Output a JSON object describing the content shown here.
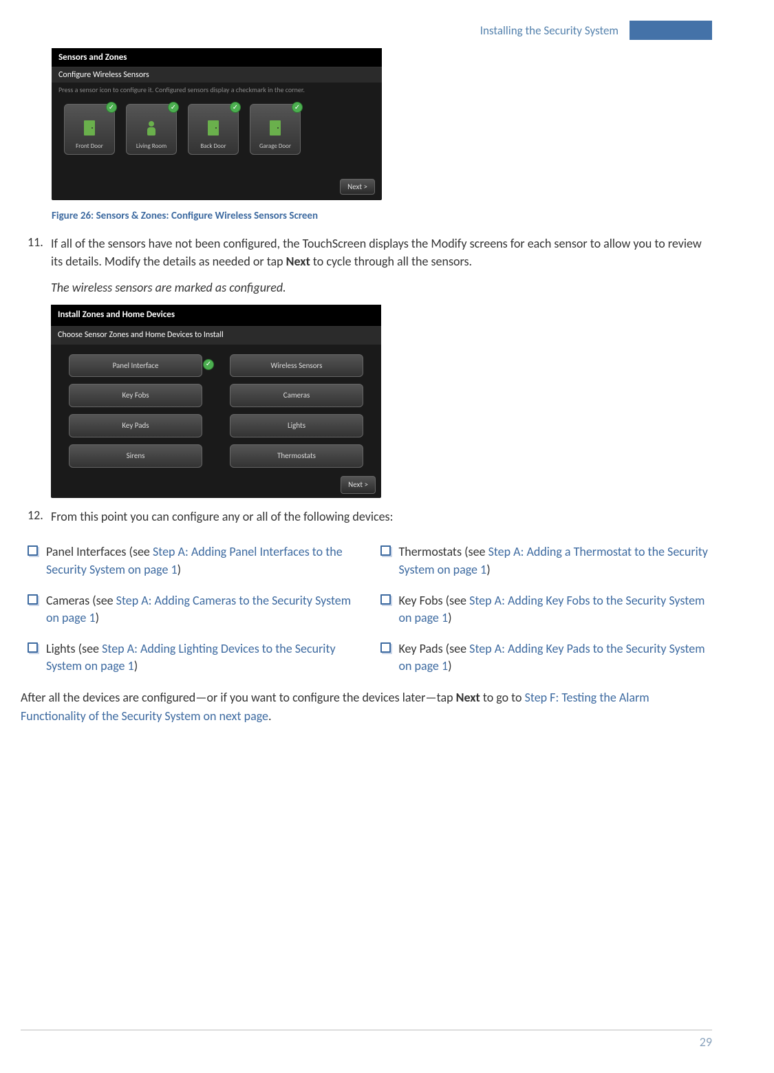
{
  "header": {
    "title": "Installing the Security System"
  },
  "screenshot1": {
    "title": "Sensors and Zones",
    "subtitle": "Configure Wireless Sensors",
    "help": "Press a sensor icon to configure it.  Configured sensors display a checkmark in the corner.",
    "sensors": [
      {
        "label": "Front Door",
        "glyph": "door",
        "checked": true
      },
      {
        "label": "Living Room",
        "glyph": "person",
        "checked": true
      },
      {
        "label": "Back Door",
        "glyph": "door",
        "checked": true
      },
      {
        "label": "Garage Door",
        "glyph": "door",
        "checked": true
      }
    ],
    "next_label": "Next >"
  },
  "figure_caption": "Figure 26:  Sensors & Zones: Configure Wireless Sensors Screen",
  "step11": {
    "num": "11.",
    "text_a": "If all of the sensors have not been configured, the TouchScreen displays the Modify screens for each sensor to allow you to review its details. Modify the details as needed or tap ",
    "bold": "Next",
    "text_b": " to cycle through all the sensors.",
    "italic": "The wireless sensors are marked as configured."
  },
  "screenshot2": {
    "title": "Install Zones and Home Devices",
    "subtitle": "Choose Sensor Zones and Home Devices to Install",
    "devices": [
      {
        "label": "Panel Interface",
        "checked": true
      },
      {
        "label": "Wireless Sensors"
      },
      {
        "label": "Key Fobs"
      },
      {
        "label": "Cameras"
      },
      {
        "label": "Key Pads"
      },
      {
        "label": "Lights"
      },
      {
        "label": "Sirens"
      },
      {
        "label": "Thermostats"
      }
    ],
    "next_label": "Next >"
  },
  "step12": {
    "num": "12.",
    "text": "From this point you can configure any or all of the following devices:"
  },
  "check_items": [
    {
      "lead": "Panel Interfaces (see ",
      "link": "Step A: Adding Panel Interfaces to the Security System on page 1",
      "tail": ")"
    },
    {
      "lead": "Thermostats (see ",
      "link": "Step A: Adding a Thermostat to the Security System on page 1",
      "tail": ")"
    },
    {
      "lead": "Cameras (see ",
      "link": "Step A: Adding Cameras to the Security System on page 1",
      "tail": ")"
    },
    {
      "lead": "Key Fobs (see ",
      "link": "Step A: Adding Key Fobs to the Security System on page 1",
      "tail": ")"
    },
    {
      "lead": "Lights (see ",
      "link": "Step A: Adding Lighting Devices to the Security System on page 1",
      "tail": ")"
    },
    {
      "lead": "Key Pads (see ",
      "link": "Step A: Adding Key Pads to the Security System on page 1",
      "tail": ")"
    }
  ],
  "after": {
    "a": "After all the devices are configured—or if you want to configure the devices later—tap ",
    "b": "Next",
    "c": " to go to ",
    "link": "Step F: Testing the Alarm Functionality of the Security System on next page",
    "d": "."
  },
  "page_number": "29"
}
